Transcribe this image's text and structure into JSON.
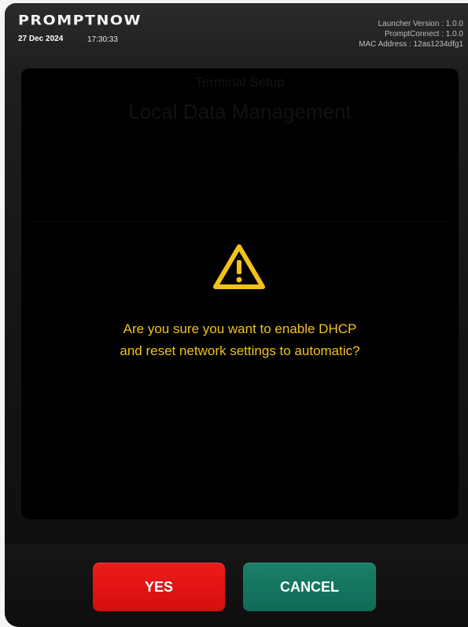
{
  "header": {
    "brand": "PROMPTNOW",
    "date": "27 Dec 2024",
    "time": "17:30:33",
    "launcher_version": "Launcher Version : 1.0.0",
    "promptconnect_version": "PromptConnect : 1.0.0",
    "mac_address": "MAC Address : 12as1234dfg1"
  },
  "background_screen": {
    "subtitle": "Terminal Setup",
    "title": "Local Data Management"
  },
  "dialog": {
    "icon": "warning-triangle-icon",
    "message_line1": "Are you sure you want to enable DHCP",
    "message_line2": "and reset network settings to automatic?",
    "yes_label": "YES",
    "cancel_label": "CANCEL"
  },
  "colors": {
    "warning": "#F2C21B",
    "yes_button": "#E51515",
    "cancel_button": "#147560",
    "panel": "#000000"
  }
}
